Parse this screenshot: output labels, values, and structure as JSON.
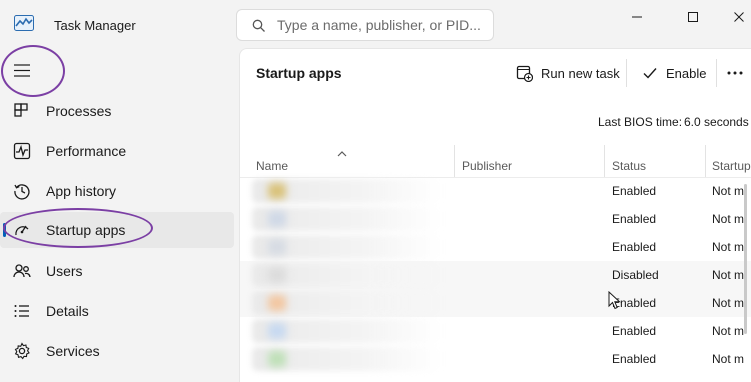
{
  "window": {
    "title": "Task Manager",
    "search_placeholder": "Type a name, publisher, or PID...",
    "accent_color": "#005fb8",
    "annotation_color": "#7b3fa4"
  },
  "sidebar": {
    "menu_icon": "hamburger-icon",
    "items": [
      {
        "label": "Processes",
        "icon": "processes-icon",
        "active": false
      },
      {
        "label": "Performance",
        "icon": "performance-icon",
        "active": false
      },
      {
        "label": "App history",
        "icon": "history-icon",
        "active": false
      },
      {
        "label": "Startup apps",
        "icon": "startup-icon",
        "active": true
      },
      {
        "label": "Users",
        "icon": "users-icon",
        "active": false
      },
      {
        "label": "Details",
        "icon": "details-icon",
        "active": false
      },
      {
        "label": "Services",
        "icon": "services-icon",
        "active": false
      }
    ]
  },
  "main": {
    "title": "Startup apps",
    "toolbar": {
      "run_new_task": "Run new task",
      "enable": "Enable",
      "more": "more-options-icon"
    },
    "bios_label": "Last BIOS time:",
    "bios_value": "6.0 seconds",
    "columns": [
      "Name",
      "Publisher",
      "Status",
      "Startup"
    ],
    "rows": [
      {
        "status": "Enabled",
        "impact": "Not m"
      },
      {
        "status": "Enabled",
        "impact": "Not m"
      },
      {
        "status": "Enabled",
        "impact": "Not m"
      },
      {
        "status": "Disabled",
        "impact": "Not m"
      },
      {
        "status": "Enabled",
        "impact": "Not m"
      },
      {
        "status": "Enabled",
        "impact": "Not m"
      },
      {
        "status": "Enabled",
        "impact": "Not m"
      }
    ]
  }
}
